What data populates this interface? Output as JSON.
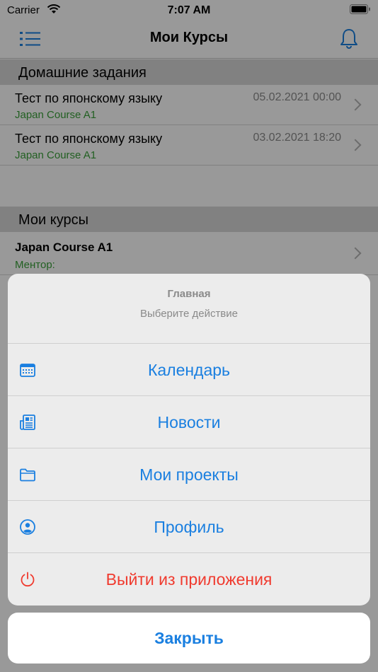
{
  "status_bar": {
    "carrier": "Carrier",
    "time": "7:07 AM"
  },
  "nav": {
    "title": "Мои Курсы"
  },
  "homework": {
    "header": "Домашние задания",
    "items": [
      {
        "title": "Тест по японскому языку",
        "course": "Japan Course A1",
        "date": "05.02.2021 00:00"
      },
      {
        "title": "Тест по японскому языку",
        "course": "Japan Course A1",
        "date": "03.02.2021 18:20"
      }
    ]
  },
  "courses": {
    "header": "Мои курсы",
    "items": [
      {
        "title": "Japan Course A1",
        "mentor": "Ментор:"
      }
    ]
  },
  "sheet": {
    "title": "Главная",
    "message": "Выберите действие",
    "actions": [
      {
        "label": "Календарь",
        "icon": "calendar-icon"
      },
      {
        "label": "Новости",
        "icon": "news-icon"
      },
      {
        "label": "Мои проекты",
        "icon": "folder-icon"
      },
      {
        "label": "Профиль",
        "icon": "profile-icon"
      },
      {
        "label": "Выйти из приложения",
        "icon": "power-icon"
      }
    ],
    "cancel": "Закрыть"
  },
  "colors": {
    "accent": "#1a7fe0",
    "destructive": "#f03a2e",
    "course_green": "#3aa03a"
  }
}
